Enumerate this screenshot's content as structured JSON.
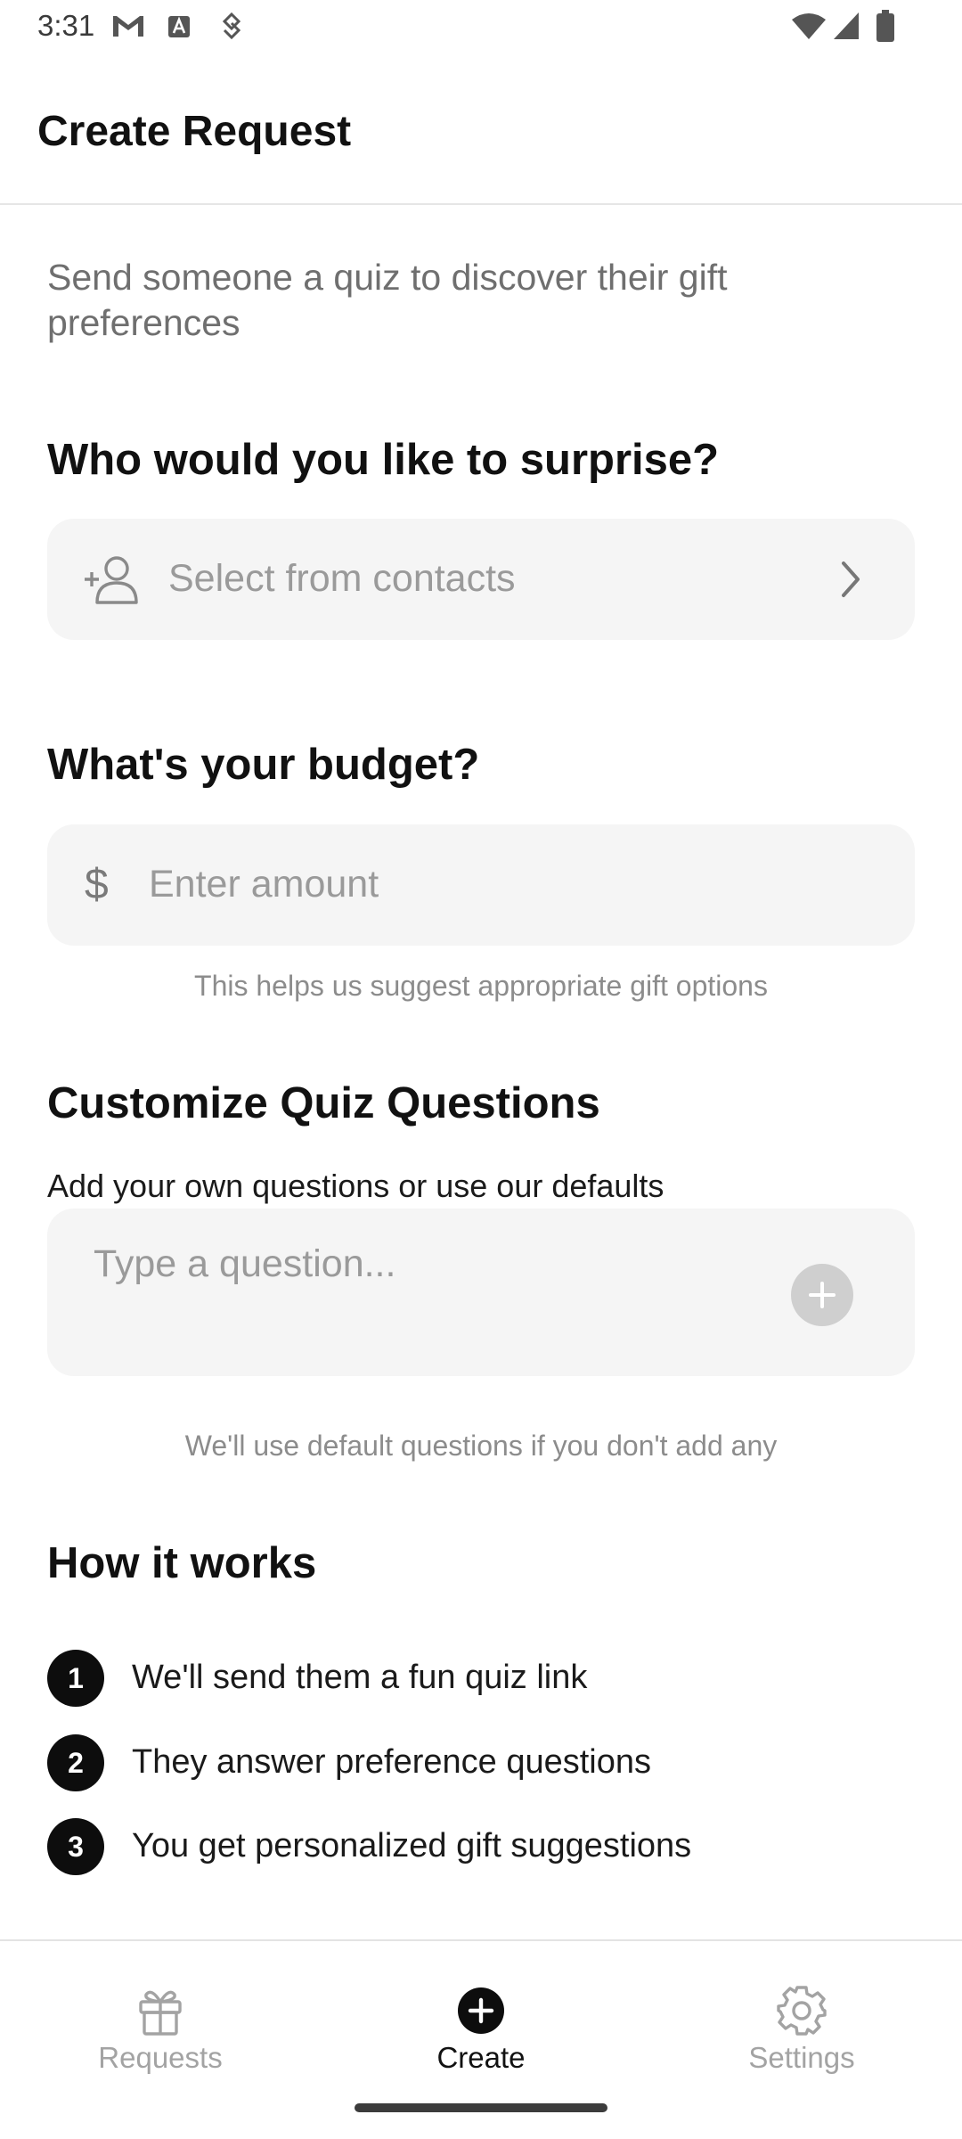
{
  "status_bar": {
    "time": "3:31",
    "left_icons": [
      "gmail-icon",
      "text-icon",
      "usb-debug-icon"
    ],
    "right_icons": [
      "wifi-icon",
      "signal-icon",
      "battery-icon"
    ]
  },
  "header": {
    "title": "Create Request"
  },
  "intro": {
    "subtitle": "Send someone a quiz to discover their gift preferences"
  },
  "recipient": {
    "heading": "Who would you like to surprise?",
    "placeholder": "Select from contacts",
    "icon": "person-add-icon"
  },
  "budget": {
    "heading": "What's your budget?",
    "currency_symbol": "$",
    "placeholder": "Enter amount",
    "hint": "This helps us suggest appropriate gift options"
  },
  "quiz": {
    "heading": "Customize Quiz Questions",
    "description": "Add your own questions or use our defaults",
    "placeholder": "Type a question...",
    "hint": "We'll use default questions if you don't add any"
  },
  "how_it_works": {
    "heading": "How it works",
    "steps": [
      {
        "number": "1",
        "text": "We'll send them a fun quiz link"
      },
      {
        "number": "2",
        "text": "They answer preference questions"
      },
      {
        "number": "3",
        "text": "You get personalized gift suggestions"
      }
    ]
  },
  "bottom_nav": {
    "items": [
      {
        "label": "Requests",
        "icon": "gift-icon",
        "active": false
      },
      {
        "label": "Create",
        "icon": "add-circle-icon",
        "active": true
      },
      {
        "label": "Settings",
        "icon": "gear-icon",
        "active": false
      }
    ]
  },
  "colors": {
    "accent": "#0d0d0d",
    "field_background": "#f5f5f5",
    "muted_text": "#9a9a9a",
    "inactive_nav": "#a3a3a3"
  }
}
